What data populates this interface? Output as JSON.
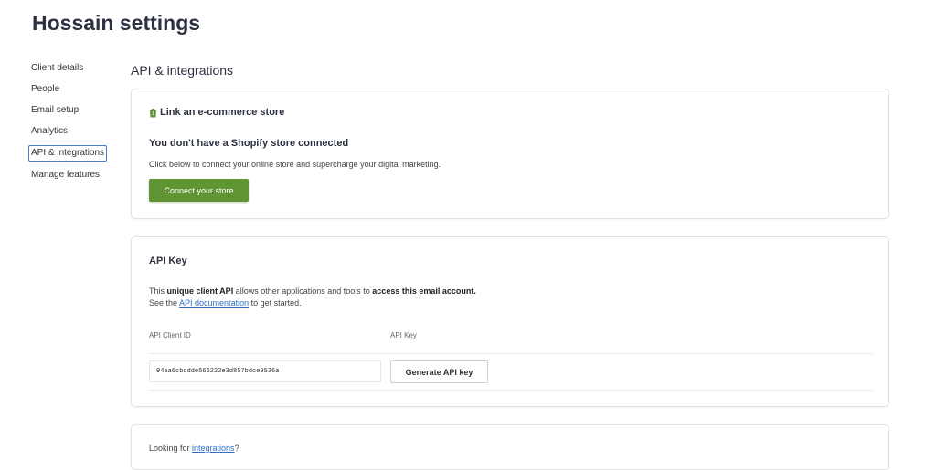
{
  "page": {
    "title": "Hossain settings"
  },
  "sidebar": {
    "items": [
      {
        "label": "Client details"
      },
      {
        "label": "People"
      },
      {
        "label": "Email setup"
      },
      {
        "label": "Analytics"
      },
      {
        "label": "API & integrations",
        "active": true
      },
      {
        "label": "Manage features"
      }
    ]
  },
  "main": {
    "heading": "API & integrations",
    "shopify_card": {
      "title": "Link an e-commerce store",
      "icon": "shopify-bag-icon",
      "heading": "You don't have a Shopify store connected",
      "description": "Click below to connect your online store and supercharge your digital marketing.",
      "button_label": "Connect your store"
    },
    "api_card": {
      "title": "API Key",
      "desc_1": "This ",
      "desc_bold_1": "unique client API",
      "desc_2": " allows other applications and tools to ",
      "desc_bold_2": "access this email account.",
      "desc_3": "See the ",
      "desc_link": "API documentation",
      "desc_4": " to get started.",
      "client_id_label": "API Client ID",
      "api_key_label": "API Key",
      "client_id_value": "94aa6cbcdde566222e3d857bdce9536a",
      "generate_button": "Generate API key"
    },
    "integrations_card": {
      "text": "Looking for ",
      "link": "integrations",
      "suffix": "?"
    }
  },
  "colors": {
    "primary_button": "#5f9533",
    "link": "#2f6fc4",
    "active_border": "#4a7cc7"
  }
}
